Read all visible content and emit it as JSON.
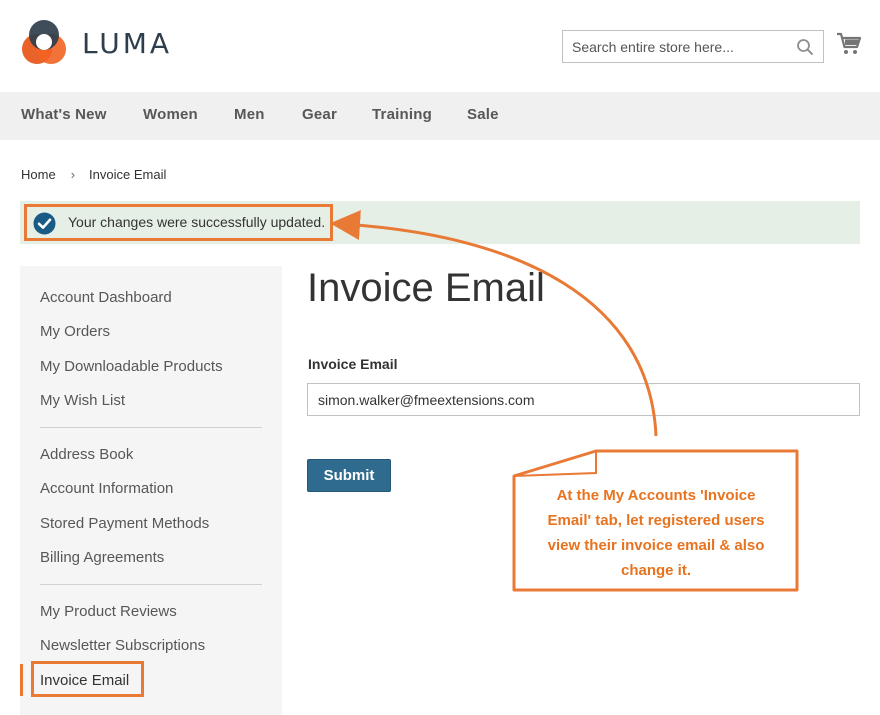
{
  "brand": {
    "name": "LUMA"
  },
  "search": {
    "placeholder": "Search entire store here..."
  },
  "nav": {
    "items": [
      "What's New",
      "Women",
      "Men",
      "Gear",
      "Training",
      "Sale"
    ]
  },
  "breadcrumb": {
    "home": "Home",
    "separator": "›",
    "current": "Invoice Email"
  },
  "message": {
    "text": "Your changes were successfully updated."
  },
  "sidebar": {
    "items": [
      "Account Dashboard",
      "My Orders",
      "My Downloadable Products",
      "My Wish List",
      "Address Book",
      "Account Information",
      "Stored Payment Methods",
      "Billing Agreements",
      "My Product Reviews",
      "Newsletter Subscriptions",
      "Invoice Email"
    ],
    "active_index": 10
  },
  "main": {
    "title": "Invoice Email",
    "field_label": "Invoice Email",
    "field_value": "simon.walker@fmeextensions.com",
    "submit_label": "Submit"
  },
  "callout": {
    "lines": [
      "At the My Accounts 'Invoice",
      "Email' tab, let registered users",
      "view their invoice email & also",
      "change it."
    ]
  },
  "colors": {
    "accent": "#e87a36",
    "primary_button": "#2f6b8e",
    "success_bg": "#e5efe5",
    "nav_bg": "#f0f0f0",
    "sidebar_bg": "#f5f5f5"
  }
}
